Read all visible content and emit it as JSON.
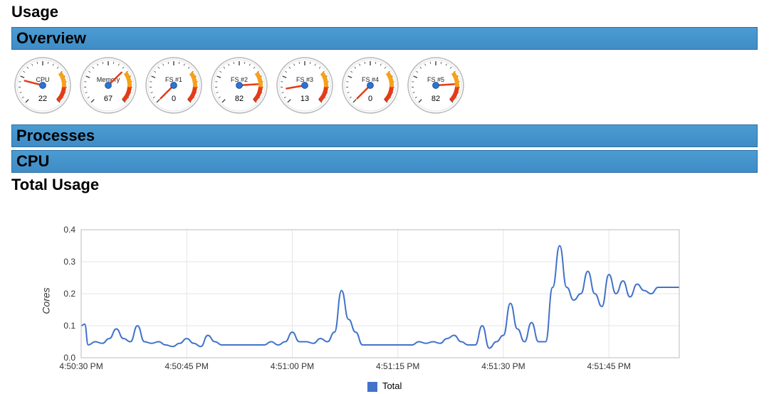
{
  "headings": {
    "usage": "Usage",
    "overview": "Overview",
    "processes": "Processes",
    "cpu": "CPU",
    "total_usage": "Total Usage"
  },
  "gauges": [
    {
      "label": "CPU",
      "value": 22
    },
    {
      "label": "Memory",
      "value": 67
    },
    {
      "label": "FS #1",
      "value": 0
    },
    {
      "label": "FS #2",
      "value": 82
    },
    {
      "label": "FS #3",
      "value": 13
    },
    {
      "label": "FS #4",
      "value": 0
    },
    {
      "label": "FS #5",
      "value": 82
    }
  ],
  "chart_data": {
    "type": "line",
    "title": "Total Usage",
    "ylabel": "Cores",
    "xlabel": "",
    "ylim": [
      0,
      0.4
    ],
    "x_tick_labels": [
      "4:50:30 PM",
      "4:50:45 PM",
      "4:51:00 PM",
      "4:51:15 PM",
      "4:51:30 PM",
      "4:51:45 PM"
    ],
    "series": [
      {
        "name": "Total",
        "color": "#4273c9",
        "x": [
          0,
          0.5,
          1,
          2,
          3,
          4,
          5,
          6,
          7,
          8,
          9,
          10,
          11,
          12,
          13,
          14,
          15,
          16,
          17,
          18,
          19,
          20,
          21,
          22,
          23,
          24,
          25,
          26,
          27,
          28,
          29,
          30,
          31,
          32,
          33,
          34,
          35,
          36,
          37,
          38,
          39,
          40,
          41,
          42,
          43,
          44,
          45,
          46,
          47,
          48,
          49,
          50,
          51,
          52,
          53,
          54,
          55,
          56,
          57,
          58,
          59,
          60,
          61,
          62,
          63,
          64,
          65,
          66,
          67,
          68,
          69,
          70,
          71,
          72,
          73,
          74,
          75,
          76,
          77,
          78,
          79,
          80,
          81,
          82,
          83,
          84,
          85
        ],
        "y": [
          0.1,
          0.105,
          0.04,
          0.05,
          0.045,
          0.06,
          0.09,
          0.06,
          0.05,
          0.1,
          0.05,
          0.045,
          0.05,
          0.04,
          0.035,
          0.045,
          0.06,
          0.045,
          0.035,
          0.07,
          0.05,
          0.04,
          0.04,
          0.04,
          0.04,
          0.04,
          0.04,
          0.04,
          0.05,
          0.04,
          0.05,
          0.08,
          0.05,
          0.05,
          0.045,
          0.06,
          0.05,
          0.08,
          0.21,
          0.12,
          0.08,
          0.04,
          0.04,
          0.04,
          0.04,
          0.04,
          0.04,
          0.04,
          0.04,
          0.05,
          0.045,
          0.05,
          0.045,
          0.06,
          0.07,
          0.05,
          0.04,
          0.04,
          0.1,
          0.03,
          0.05,
          0.07,
          0.17,
          0.09,
          0.05,
          0.11,
          0.05,
          0.05,
          0.22,
          0.35,
          0.22,
          0.18,
          0.2,
          0.27,
          0.2,
          0.16,
          0.26,
          0.2,
          0.24,
          0.19,
          0.23,
          0.21,
          0.2,
          0.22,
          0.22,
          0.22,
          0.22
        ]
      }
    ],
    "legend": {
      "label": "Total"
    }
  }
}
